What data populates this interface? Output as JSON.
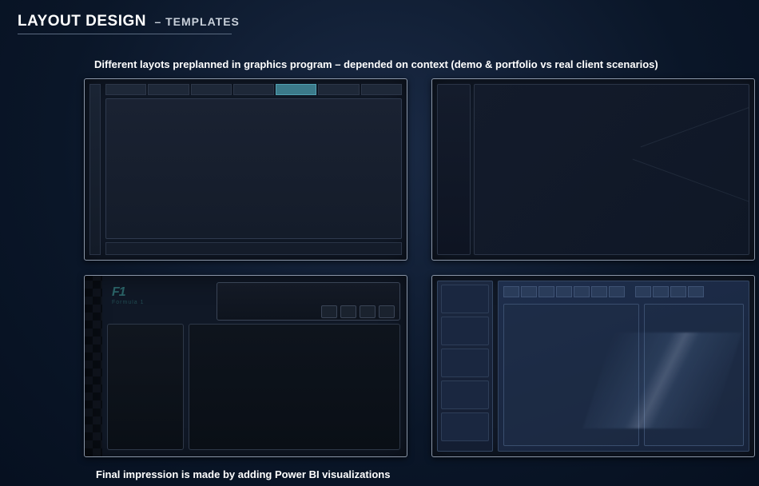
{
  "header": {
    "title": "LAYOUT DESIGN",
    "subtitle": "– TEMPLATES"
  },
  "subheading": "Different layots preplanned in graphics program – depended on context (demo & portfolio vs real client scenarios)",
  "t3": {
    "logo_main": "F1",
    "logo_sub": "Formula 1"
  },
  "footer": "Final impression is made by adding Power BI visualizations"
}
